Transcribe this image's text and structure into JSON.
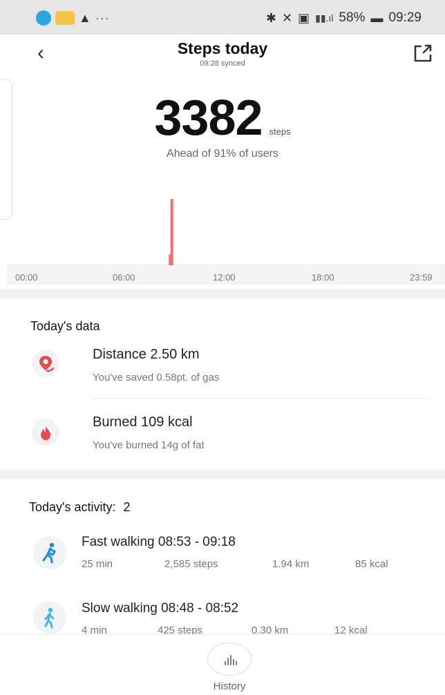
{
  "status_bar": {
    "battery": "58%",
    "time": "09:29",
    "colors": {
      "bubble": "#2aa6e0",
      "message": "#f4c542"
    },
    "icons": [
      "chat-bubble-icon",
      "message-icon",
      "warning-icon",
      "more-icon",
      "bluetooth-icon",
      "mute-icon",
      "nfc-icon",
      "signal-icon",
      "battery-icon"
    ]
  },
  "header": {
    "title": "Steps today",
    "synced": "09:28 synced"
  },
  "summary": {
    "steps": "3382",
    "unit": "steps",
    "rank": "Ahead of 91% of users"
  },
  "chart_data": {
    "type": "bar",
    "x_tick_labels": [
      "00:00",
      "06:00",
      "12:00",
      "18:00",
      "23:59"
    ],
    "x_unit": "hours",
    "x_range": [
      0,
      24
    ],
    "bars": [
      {
        "start": 8.8,
        "end": 8.96,
        "value": 2585
      },
      {
        "start": 8.7,
        "end": 8.92,
        "value": 425
      }
    ],
    "bar_color": "#ef6f73"
  },
  "todays_data": {
    "title": "Today's data",
    "items": [
      {
        "main": "Distance 2.50 km",
        "sub": "You've saved 0.58pt. of gas",
        "icon": "location-pin-icon"
      },
      {
        "main": "Burned 109 kcal",
        "sub": "You've burned 14g of fat",
        "icon": "flame-icon"
      }
    ],
    "accent": "#e84a4f"
  },
  "activity": {
    "title": "Today's activity:",
    "count": "2",
    "items": [
      {
        "title": "Fast walking 08:53 - 09:18",
        "duration": "25 min",
        "steps": "2,585 steps",
        "distance": "1.94 km",
        "kcal": "85 kcal",
        "icon": "fast-walking-icon",
        "color": "#1e88e5"
      },
      {
        "title": "Slow walking 08:48 - 08:52",
        "duration": "4 min",
        "steps": "425 steps",
        "distance": "0.30 km",
        "kcal": "12 kcal",
        "icon": "slow-walking-icon",
        "color": "#3fb6e8"
      }
    ]
  },
  "bottom": {
    "history_label": "History"
  }
}
